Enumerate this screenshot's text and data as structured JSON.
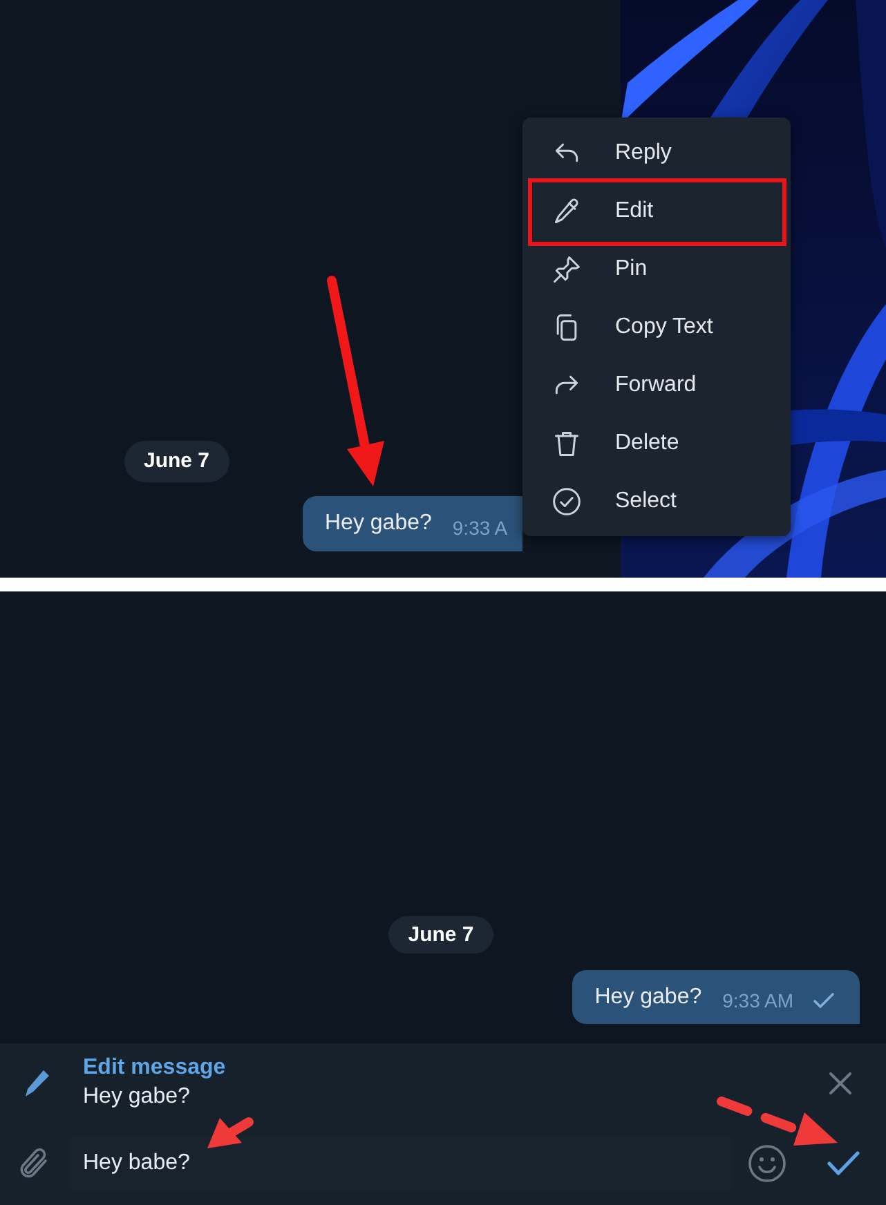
{
  "top_panel": {
    "date_badge": "June 7",
    "message": {
      "text": "Hey gabe?",
      "time": "9:33 A"
    },
    "context_menu": {
      "items": [
        {
          "label": "Reply",
          "highlighted": false
        },
        {
          "label": "Edit",
          "highlighted": true
        },
        {
          "label": "Pin",
          "highlighted": false
        },
        {
          "label": "Copy Text",
          "highlighted": false
        },
        {
          "label": "Forward",
          "highlighted": false
        },
        {
          "label": "Delete",
          "highlighted": false
        },
        {
          "label": "Select",
          "highlighted": false
        }
      ]
    }
  },
  "bottom_panel": {
    "date_badge": "June 7",
    "message": {
      "text": "Hey gabe?",
      "time": "9:33 AM",
      "sent": true
    },
    "edit_bar": {
      "title": "Edit message",
      "original_text": "Hey gabe?",
      "input": {
        "value": "Hey babe?"
      }
    }
  }
}
